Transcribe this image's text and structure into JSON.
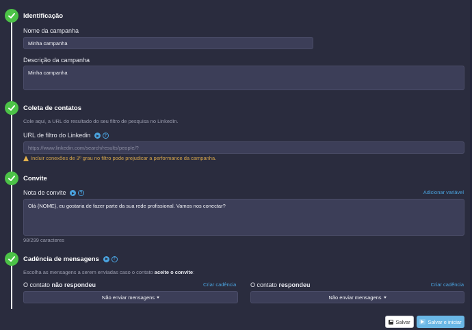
{
  "sections": {
    "identificacao": {
      "title": "Identificação"
    },
    "coleta": {
      "title": "Coleta de contatos"
    },
    "convite": {
      "title": "Convite"
    },
    "cadencia": {
      "title": "Cadência de mensagens"
    }
  },
  "campaign": {
    "name_label": "Nome da campanha",
    "name_value": "Minha campanha",
    "description_label": "Descrição da campanha",
    "description_value": "Minha campanha"
  },
  "coleta": {
    "hint": "Cole aqui, a URL do resultado do seu filtro de pesquisa no LinkedIn.",
    "url_label": "URL de filtro do Linkedin",
    "url_placeholder": "https://www.linkedin.com/search/results/people/?",
    "warning": "Incluir conexões de 3º grau no filtro pode prejudicar a performance da campanha."
  },
  "convite": {
    "note_label": "Nota de convite",
    "add_variable": "Adicionar variável",
    "note_value": "Olá {NOME}, eu gostaria de fazer parte da sua rede profissional. Vamos nos conectar?",
    "char_count": "98/299 caracteres"
  },
  "cadencia": {
    "hint_prefix": "Escolha as mensagens a serem enviadas caso o contato ",
    "hint_bold": "aceite o convite",
    "hint_suffix": ":",
    "left_label_prefix": "O contato ",
    "left_label_bold": "não respondeu",
    "right_label_prefix": "O contato ",
    "right_label_bold": "respondeu",
    "create_cadence": "Criar cadência",
    "dropdown_left": "Não enviar mensagens",
    "dropdown_right": "Não enviar mensagens"
  },
  "footer": {
    "save": "Salvar",
    "save_start": "Salvar e iniciar"
  },
  "colors": {
    "background": "#2a2c3e",
    "input_bg": "#3c3e58",
    "check_green": "#4cc247",
    "link_blue": "#4aa3df",
    "warning": "#d3a34a"
  }
}
